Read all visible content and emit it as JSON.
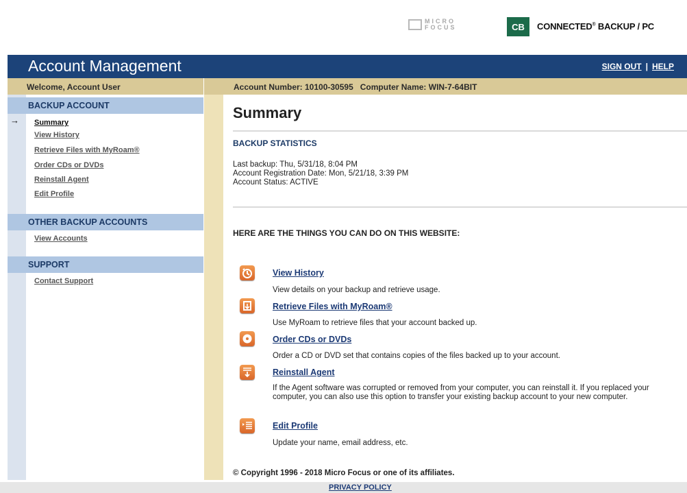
{
  "brand": {
    "micro_focus_line1": "MICRO",
    "micro_focus_line2": "FOCUS",
    "cb_badge": "CB",
    "product_name": "CONNECTED",
    "product_suffix": " BACKUP / PC",
    "registered": "®"
  },
  "header": {
    "title": "Account Management",
    "sign_out": "SIGN OUT",
    "separator": "|",
    "help": "HELP"
  },
  "infobar": {
    "welcome": "Welcome, Account User",
    "account_info": "Account Number: 10100-30595   Computer Name: WIN-7-64BIT"
  },
  "sidebar": {
    "sections": [
      {
        "title": "BACKUP ACCOUNT",
        "items": [
          {
            "label": "Summary",
            "active": true
          },
          {
            "label": "View History"
          },
          {
            "label": "Retrieve Files with MyRoam®"
          },
          {
            "label": "Order CDs or DVDs"
          },
          {
            "label": "Reinstall Agent"
          },
          {
            "label": "Edit Profile"
          }
        ]
      },
      {
        "title": "OTHER BACKUP ACCOUNTS",
        "items": [
          {
            "label": "View Accounts"
          }
        ]
      },
      {
        "title": "SUPPORT",
        "items": [
          {
            "label": "Contact Support"
          }
        ]
      }
    ],
    "active_marker": "→"
  },
  "main": {
    "title": "Summary",
    "stats_heading": "BACKUP STATISTICS",
    "stats": [
      "Last backup: Thu, 5/31/18, 8:04 PM",
      "Account Registration Date: Mon, 5/21/18, 3:39 PM",
      "Account Status: ACTIVE"
    ],
    "things_heading": "HERE ARE THE THINGS YOU CAN DO ON THIS WEBSITE:",
    "features": [
      {
        "icon": "history-clock-icon",
        "label": "View History",
        "desc": "View details on your backup and retrieve usage."
      },
      {
        "icon": "retrieve-files-icon",
        "label": "Retrieve Files with MyRoam®",
        "desc": "Use MyRoam to retrieve files that your account backed up."
      },
      {
        "icon": "disc-icon",
        "label": "Order CDs or DVDs",
        "desc": "Order a CD or DVD set that contains copies of the files backed up to your account."
      },
      {
        "icon": "reinstall-download-icon",
        "label": "Reinstall Agent",
        "desc": "If the Agent software was corrupted or removed from your computer, you can reinstall it. If you replaced your computer, you can also use this option to transfer your existing backup account to your new computer."
      },
      {
        "icon": "profile-list-icon",
        "label": "Edit Profile",
        "desc": "Update your name, email address, etc."
      }
    ],
    "copyright": "© Copyright 1996 - 2018 Micro Focus or one of its affiliates."
  },
  "footer": {
    "privacy": "PRIVACY POLICY"
  },
  "colors": {
    "header_blue": "#1c4379",
    "section_blue": "#afc6e2",
    "tan": "#d9c997",
    "accent_orange": "#e67a35",
    "brand_green": "#1c6b4a"
  }
}
